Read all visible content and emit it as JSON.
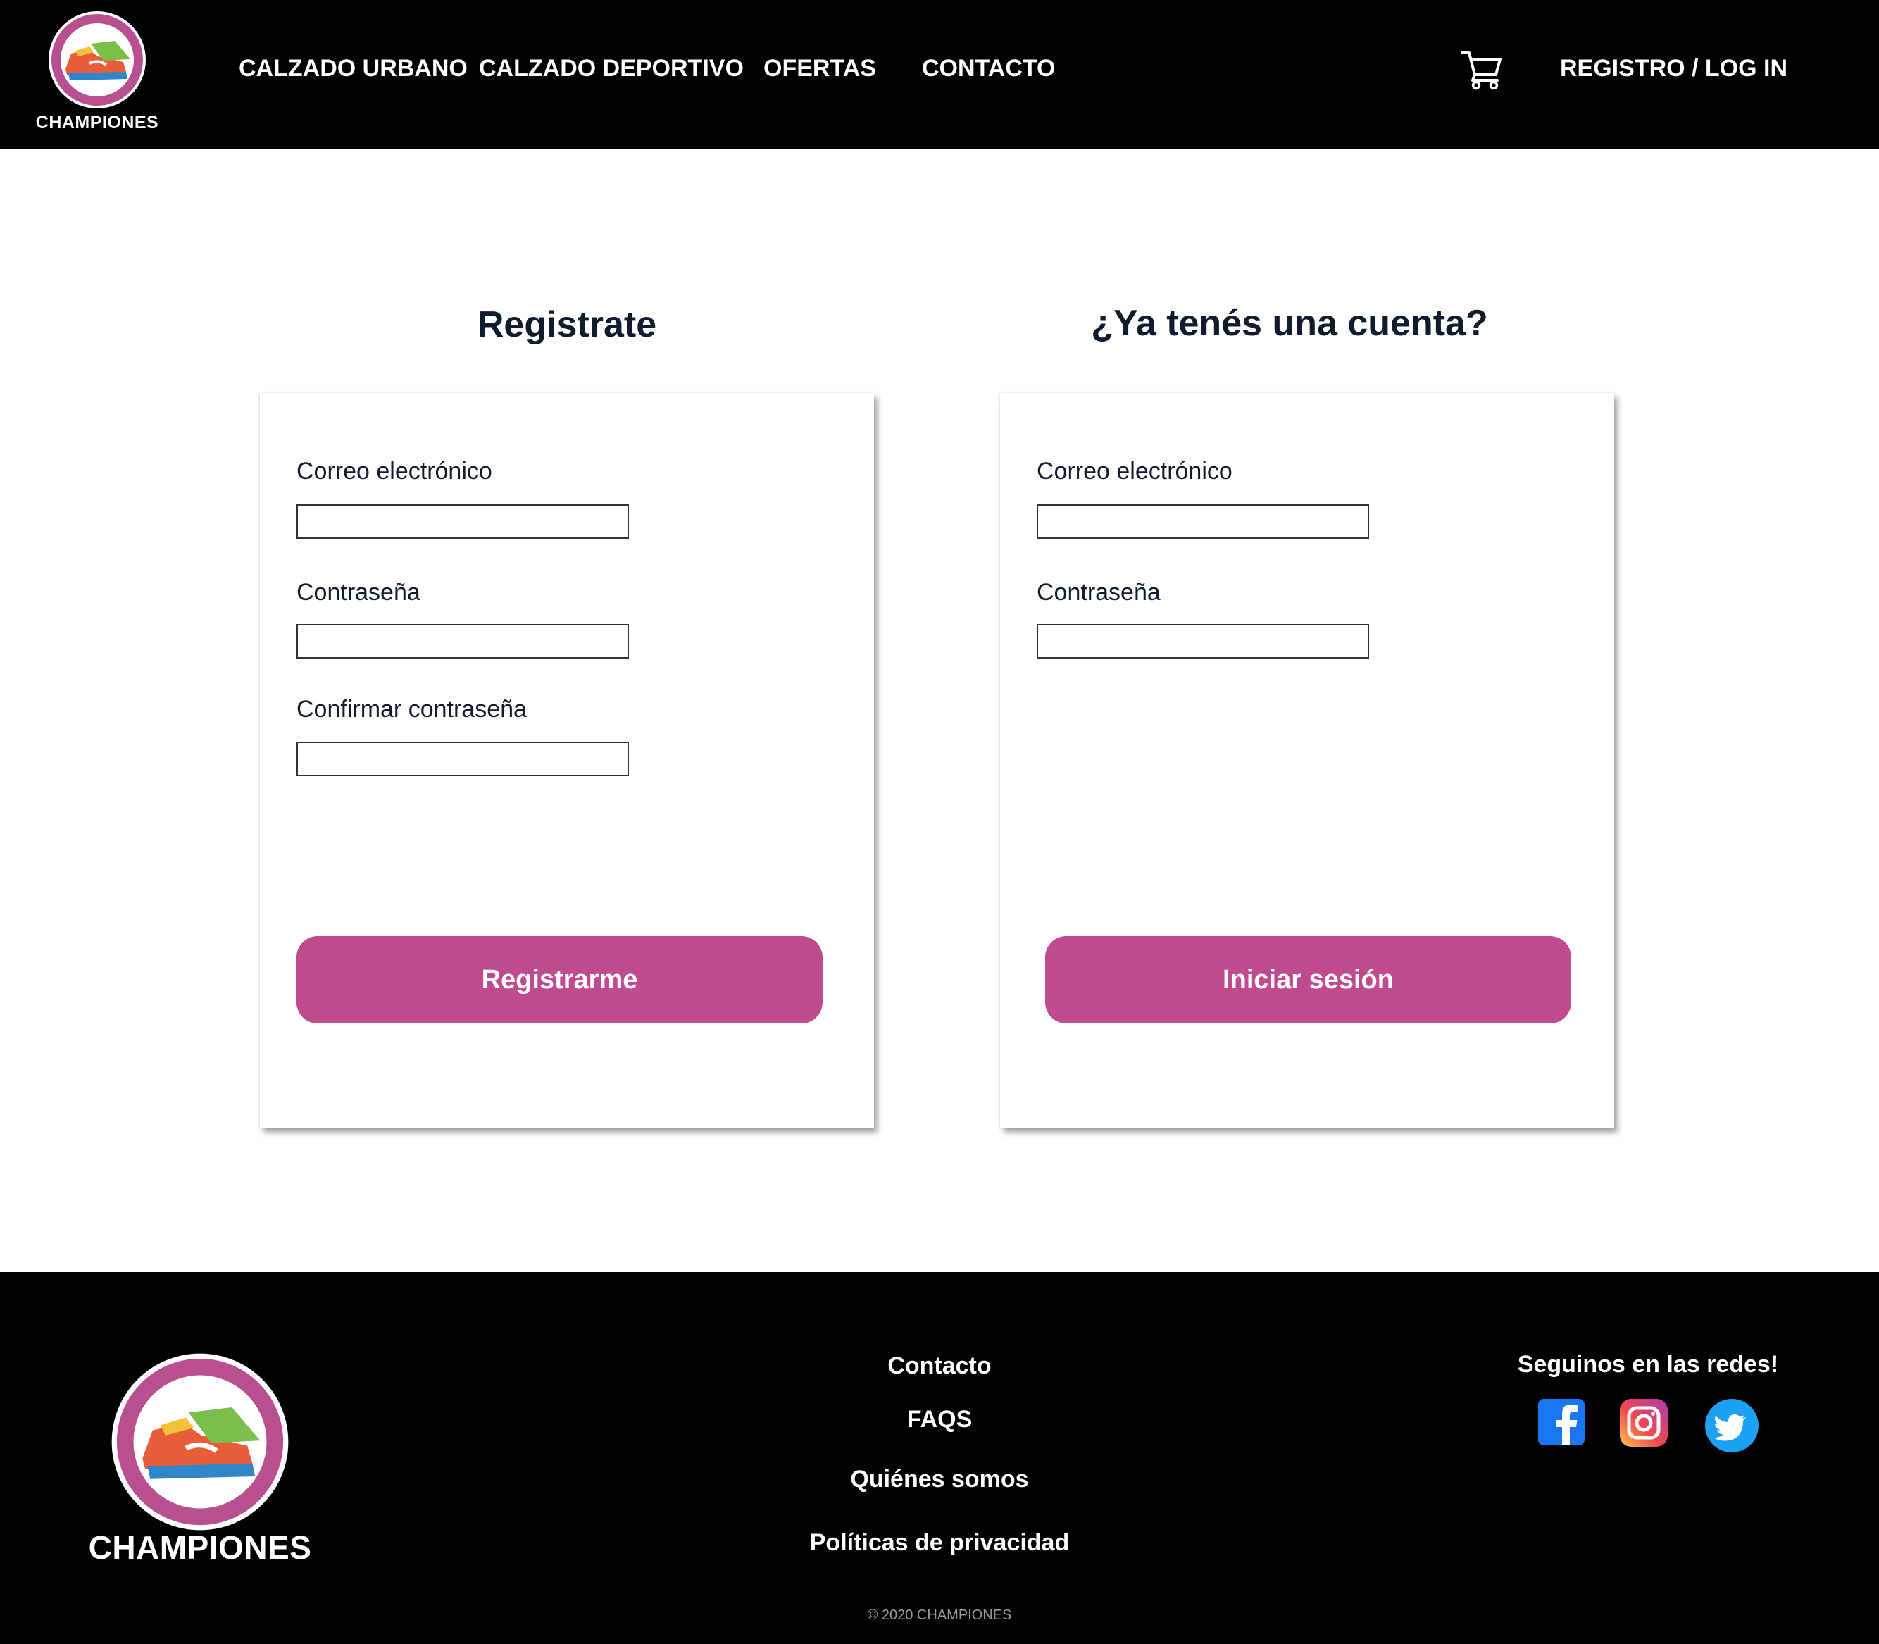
{
  "header": {
    "brand": "CHAMPIONES",
    "nav": [
      {
        "label": "CALZADO URBANO"
      },
      {
        "label": "CALZADO DEPORTIVO"
      },
      {
        "label": "OFERTAS"
      },
      {
        "label": "CONTACTO"
      }
    ],
    "cart_icon": "shopping-cart-icon",
    "auth_link": "REGISTRO / LOG IN"
  },
  "register": {
    "title": "Registrate",
    "fields": [
      {
        "label": "Correo electrónico",
        "value": ""
      },
      {
        "label": "Contraseña",
        "value": ""
      },
      {
        "label": "Confirmar contraseña",
        "value": ""
      }
    ],
    "button": "Registrarme"
  },
  "login": {
    "title": "¿Ya tenés una cuenta?",
    "fields": [
      {
        "label": "Correo electrónico",
        "value": ""
      },
      {
        "label": "Contraseña",
        "value": ""
      }
    ],
    "button": "Iniciar sesión"
  },
  "footer": {
    "brand": "CHAMPIONES",
    "links": [
      {
        "label": "Contacto"
      },
      {
        "label": "FAQS"
      },
      {
        "label": "Quiénes somos"
      },
      {
        "label": "Políticas de privacidad"
      }
    ],
    "social_title": "Seguinos en las redes!",
    "social": [
      {
        "icon": "facebook-icon"
      },
      {
        "icon": "instagram-icon"
      },
      {
        "icon": "twitter-icon"
      }
    ],
    "copyright": "© 2020 CHAMPIONES"
  },
  "colors": {
    "accent": "#bf4a8e",
    "header_bg": "#000000",
    "heading_text": "#0f1c2e"
  }
}
